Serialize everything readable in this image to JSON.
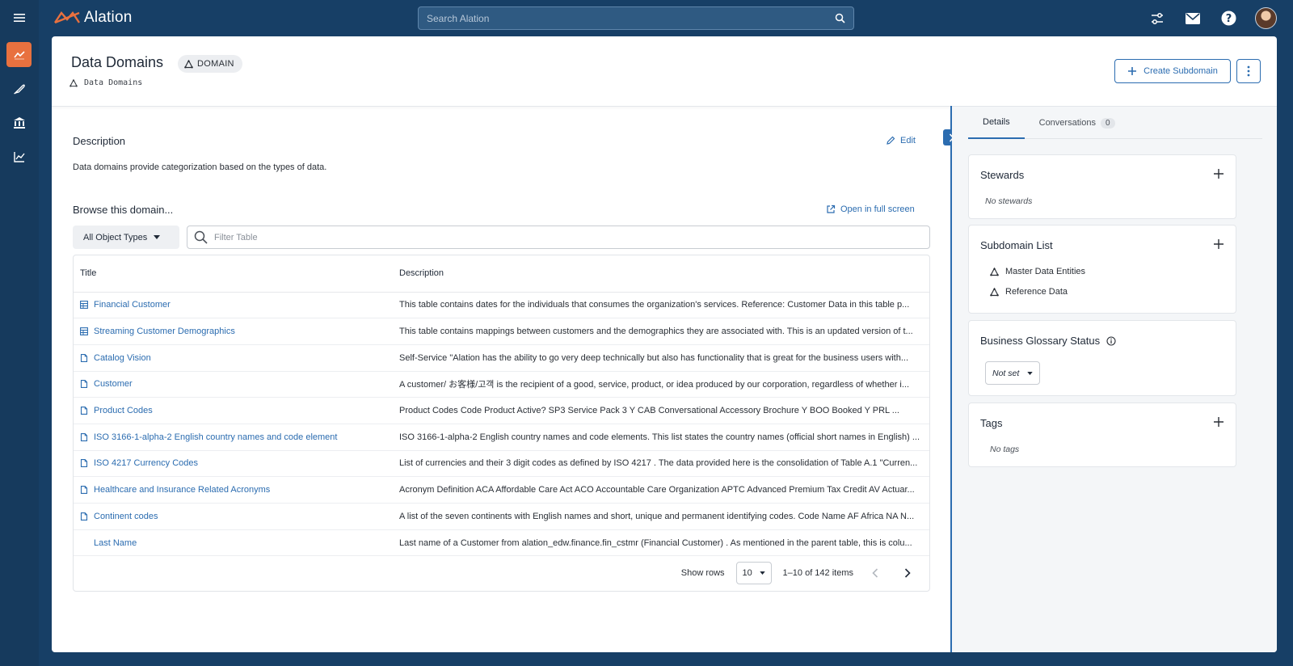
{
  "app": {
    "name": "Alation"
  },
  "search": {
    "placeholder": "Search Alation"
  },
  "header": {
    "title": "Data Domains",
    "badge": "DOMAIN",
    "breadcrumb": "Data Domains",
    "create_label": "Create Subdomain"
  },
  "description": {
    "heading": "Description",
    "edit_label": "Edit",
    "text": "Data domains provide categorization based on the types of data."
  },
  "browse": {
    "heading": "Browse this domain...",
    "open_label": "Open in full screen",
    "type_filter": "All Object Types",
    "filter_placeholder": "Filter Table",
    "columns": {
      "title": "Title",
      "description": "Description"
    },
    "rows": [
      {
        "icon": "table-icon",
        "title": "Financial Customer",
        "description": "This table contains dates for the individuals that consumes the organization's services. Reference:  Customer   Data in this table p..."
      },
      {
        "icon": "table-icon",
        "title": "Streaming Customer Demographics",
        "description": "This table contains mappings between customers and the demographics they are associated with.  This is an updated version of t..."
      },
      {
        "icon": "document-icon",
        "title": "Catalog Vision",
        "description": "Self-Service \"Alation has the ability to go very deep technically but also has functionality that is great for the business users with..."
      },
      {
        "icon": "document-icon",
        "title": "Customer",
        "description": "A  customer/ お客様/고객   is the recipient of a good, service, product, or idea produced by our corporation, regardless of whether i..."
      },
      {
        "icon": "document-icon",
        "title": "Product Codes",
        "description": "Product Codes Code Product Active? SP3 Service Pack 3 Y CAB Conversational Accessory Brochure Y BOO Booked Y PRL ..."
      },
      {
        "icon": "document-icon",
        "title": "ISO 3166-1-alpha-2 English country names and code element",
        "description": "ISO 3166-1-alpha-2 English country names and code elements. This list states the country names (official short names in English) ..."
      },
      {
        "icon": "document-icon",
        "title": "ISO 4217 Currency Codes",
        "description": "List of currencies and their 3 digit codes as defined by  ISO 4217 . The data provided here is the consolidation of Table A.1 \"Curren..."
      },
      {
        "icon": "document-icon",
        "title": "Healthcare and Insurance Related Acronyms",
        "description": "Acronym Definition ACA Affordable Care Act ACO Accountable Care Organization APTC Advanced Premium Tax Credit AV Actuar..."
      },
      {
        "icon": "document-icon",
        "title": "Continent codes",
        "description": "A list of the seven continents with English names and short, unique and permanent identifying codes. Code Name AF Africa NA N..."
      },
      {
        "icon": "",
        "title": "Last Name",
        "description": "Last name of a Customer from alation_edw.finance.fin_cstmr (Financial Customer) . As mentioned in the parent table, this is colu..."
      }
    ],
    "pager": {
      "show_rows_label": "Show rows",
      "rows_value": "10",
      "range_text": "1–10 of 142 items"
    }
  },
  "right": {
    "tabs": [
      {
        "label": "Details"
      },
      {
        "label": "Conversations",
        "count": "0"
      }
    ],
    "stewards": {
      "title": "Stewards",
      "empty": "No stewards"
    },
    "subdomains": {
      "title": "Subdomain List",
      "items": [
        "Master Data Entities",
        "Reference Data"
      ]
    },
    "glossary": {
      "title": "Business Glossary Status",
      "value": "Not set"
    },
    "tags": {
      "title": "Tags",
      "empty": "No tags"
    }
  },
  "colors": {
    "accent": "#2b6cb0",
    "brand_orange": "#e8713f",
    "nav_bg": "#163a5d"
  }
}
